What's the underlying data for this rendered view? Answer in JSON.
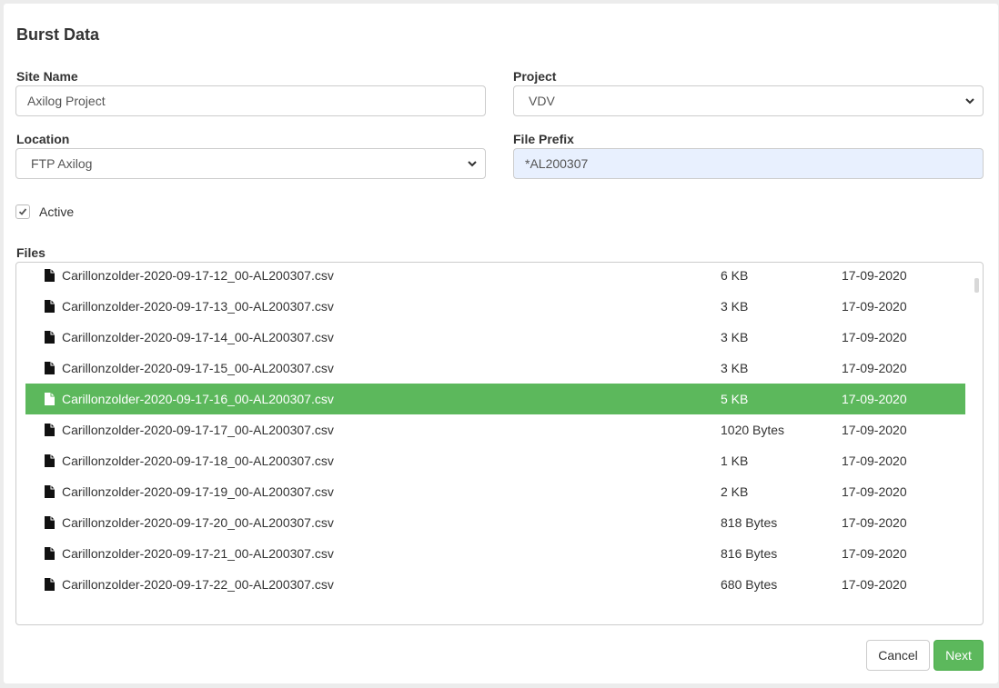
{
  "dialog": {
    "title": "Burst Data"
  },
  "form": {
    "site_name": {
      "label": "Site Name",
      "value": "Axilog Project"
    },
    "project": {
      "label": "Project",
      "value": "VDV"
    },
    "location": {
      "label": "Location",
      "value": "FTP Axilog"
    },
    "file_prefix": {
      "label": "File Prefix",
      "value": "*AL200307"
    },
    "active": {
      "label": "Active",
      "checked": true
    }
  },
  "files": {
    "label": "Files",
    "selected_index": 4,
    "rows": [
      {
        "name": "Carillonzolder-2020-09-17-12_00-AL200307.csv",
        "size": "6 KB",
        "date": "17-09-2020"
      },
      {
        "name": "Carillonzolder-2020-09-17-13_00-AL200307.csv",
        "size": "3 KB",
        "date": "17-09-2020"
      },
      {
        "name": "Carillonzolder-2020-09-17-14_00-AL200307.csv",
        "size": "3 KB",
        "date": "17-09-2020"
      },
      {
        "name": "Carillonzolder-2020-09-17-15_00-AL200307.csv",
        "size": "3 KB",
        "date": "17-09-2020"
      },
      {
        "name": "Carillonzolder-2020-09-17-16_00-AL200307.csv",
        "size": "5 KB",
        "date": "17-09-2020"
      },
      {
        "name": "Carillonzolder-2020-09-17-17_00-AL200307.csv",
        "size": "1020 Bytes",
        "date": "17-09-2020"
      },
      {
        "name": "Carillonzolder-2020-09-17-18_00-AL200307.csv",
        "size": "1 KB",
        "date": "17-09-2020"
      },
      {
        "name": "Carillonzolder-2020-09-17-19_00-AL200307.csv",
        "size": "2 KB",
        "date": "17-09-2020"
      },
      {
        "name": "Carillonzolder-2020-09-17-20_00-AL200307.csv",
        "size": "818 Bytes",
        "date": "17-09-2020"
      },
      {
        "name": "Carillonzolder-2020-09-17-21_00-AL200307.csv",
        "size": "816 Bytes",
        "date": "17-09-2020"
      },
      {
        "name": "Carillonzolder-2020-09-17-22_00-AL200307.csv",
        "size": "680 Bytes",
        "date": "17-09-2020"
      }
    ]
  },
  "buttons": {
    "cancel": "Cancel",
    "next": "Next"
  },
  "colors": {
    "selected_row": "#5cb85c",
    "next_button": "#5cb85c",
    "autofill_bg": "#e8f0fe"
  },
  "icons": {
    "file": "file-icon",
    "check": "check-icon",
    "chevron": "chevron-down-icon"
  }
}
